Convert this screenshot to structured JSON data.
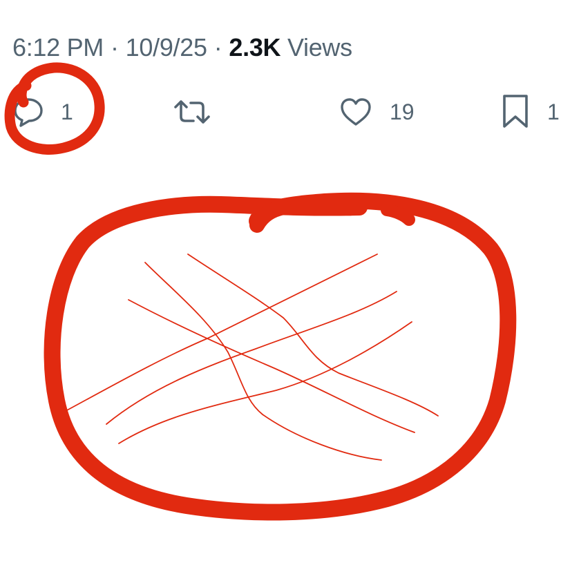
{
  "tweet_meta": {
    "time": "6:12 PM",
    "separator": "·",
    "date": "10/9/25",
    "views_count": "2.3K",
    "views_label": "Views"
  },
  "actions": {
    "reply": {
      "icon": "reply-bubble-icon",
      "count": "1"
    },
    "repost": {
      "icon": "repost-arrows-icon",
      "count": ""
    },
    "like": {
      "icon": "heart-icon",
      "count": "19"
    },
    "bookmark": {
      "icon": "bookmark-icon",
      "count": "1"
    }
  },
  "colors": {
    "meta_text": "#536471",
    "emphasis_text": "#0f1419",
    "annotation_red": "#e12a10"
  }
}
